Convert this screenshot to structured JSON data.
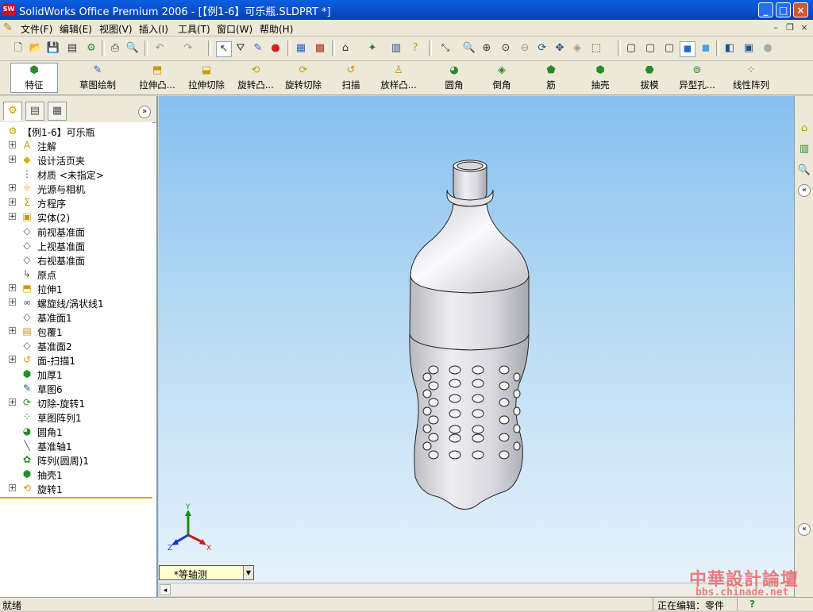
{
  "window": {
    "title": "SolidWorks Office Premium 2006 - [【例1-6】可乐瓶.SLDPRT *]",
    "app_icon_text": "SW",
    "minimize": "_",
    "maximize": "□",
    "close": "×"
  },
  "menu": {
    "items": [
      "文件(F)",
      "编辑(E)",
      "视图(V)",
      "插入(I)",
      "工具(T)",
      "窗口(W)",
      "帮助(H)"
    ],
    "mdi_minimize": "–",
    "mdi_restore": "❐",
    "mdi_close": "×"
  },
  "feature_toolbar": {
    "items": [
      "特征",
      "草图绘制",
      "拉伸凸...",
      "拉伸切除",
      "旋转凸...",
      "旋转切除",
      "扫描",
      "放样凸...",
      "圆角",
      "倒角",
      "筋",
      "抽壳",
      "拔模",
      "异型孔...",
      "线性阵列"
    ]
  },
  "feature_tree": {
    "items": [
      {
        "label": "【例1-6】可乐瓶",
        "icon": "part-icon",
        "expandable": false
      },
      {
        "label": "注解",
        "icon": "annotation-icon",
        "expandable": true
      },
      {
        "label": "设计活页夹",
        "icon": "design-binder-icon",
        "expandable": true
      },
      {
        "label": "材质 <未指定>",
        "icon": "material-icon",
        "expandable": false
      },
      {
        "label": "光源与相机",
        "icon": "lights-camera-icon",
        "expandable": true
      },
      {
        "label": "方程序",
        "icon": "equations-icon",
        "expandable": true
      },
      {
        "label": "实体(2)",
        "icon": "solid-bodies-icon",
        "expandable": true
      },
      {
        "label": "前视基准面",
        "icon": "plane-icon",
        "expandable": false
      },
      {
        "label": "上视基准面",
        "icon": "plane-icon",
        "expandable": false
      },
      {
        "label": "右视基准面",
        "icon": "plane-icon",
        "expandable": false
      },
      {
        "label": "原点",
        "icon": "origin-icon",
        "expandable": false
      },
      {
        "label": "拉伸1",
        "icon": "extrude-icon",
        "expandable": true
      },
      {
        "label": "螺旋线/涡状线1",
        "icon": "helix-icon",
        "expandable": true
      },
      {
        "label": "基准面1",
        "icon": "plane-icon",
        "expandable": false
      },
      {
        "label": "包覆1",
        "icon": "wrap-icon",
        "expandable": true
      },
      {
        "label": "基准面2",
        "icon": "plane-icon",
        "expandable": false
      },
      {
        "label": "面-扫描1",
        "icon": "sweep-icon",
        "expandable": true
      },
      {
        "label": "加厚1",
        "icon": "thicken-icon",
        "expandable": false
      },
      {
        "label": "草图6",
        "icon": "sketch-icon",
        "expandable": false
      },
      {
        "label": "切除-旋转1",
        "icon": "revolve-cut-icon",
        "expandable": true
      },
      {
        "label": "草图阵列1",
        "icon": "sketch-pattern-icon",
        "expandable": false
      },
      {
        "label": "圆角1",
        "icon": "fillet-icon",
        "expandable": false
      },
      {
        "label": "基准轴1",
        "icon": "axis-icon",
        "expandable": false
      },
      {
        "label": "阵列(圆周)1",
        "icon": "circular-pattern-icon",
        "expandable": false
      },
      {
        "label": "抽壳1",
        "icon": "shell-icon",
        "expandable": false
      },
      {
        "label": "旋转1",
        "icon": "revolve-icon",
        "expandable": true
      }
    ]
  },
  "viewport": {
    "view_name": "*等轴测",
    "triad": {
      "x": "X",
      "y": "Y",
      "z": "Z"
    }
  },
  "statusbar": {
    "left": "就绪",
    "editing": "正在编辑：零件",
    "help": "?"
  },
  "watermark": {
    "line1": "中華設計論壇",
    "line2": "bbs.chinade.net"
  },
  "colors": {
    "titlebar": "#0a4fd0",
    "viewport_top": "#86c0f0",
    "viewport_bottom": "#e6f2fb",
    "model": "#d8d8dc"
  }
}
